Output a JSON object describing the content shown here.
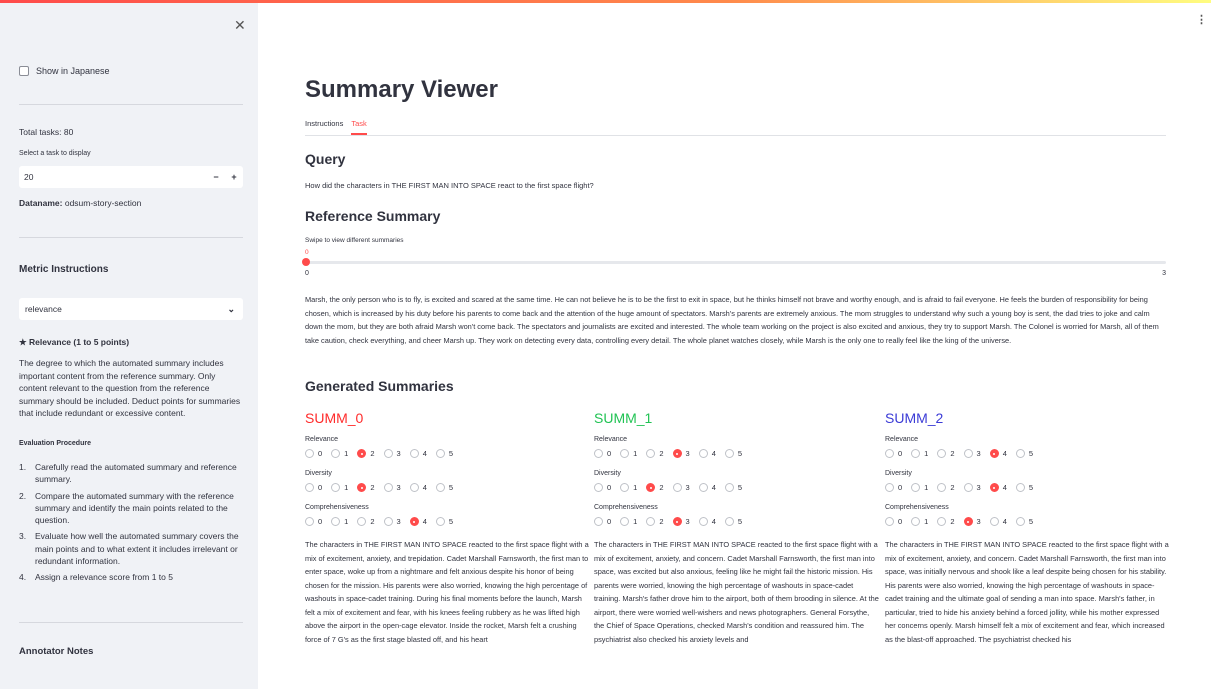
{
  "sidebar": {
    "show_japanese_label": "Show in Japanese",
    "total_tasks": "Total tasks: 80",
    "select_task_label": "Select a task to display",
    "task_value": "20",
    "stepper_minus": "−",
    "stepper_plus": "+",
    "dataname_label": "Dataname:",
    "dataname_value": "odsum-story-section",
    "metric_heading": "Metric Instructions",
    "metric_select": "relevance",
    "metric_title": "★ Relevance (1 to 5 points)",
    "metric_description": "The degree to which the automated summary includes important content from the reference summary. Only content relevant to the question from the reference summary should be included. Deduct points for summaries that include redundant or excessive content.",
    "procedure_heading": "Evaluation Procedure",
    "steps": [
      {
        "num": "1.",
        "text": "Carefully read the automated summary and reference summary."
      },
      {
        "num": "2.",
        "text": "Compare the automated summary with the reference summary and identify the main points related to the question."
      },
      {
        "num": "3.",
        "text": "Evaluate how well the automated summary covers the main points and to what extent it includes irrelevant or redundant information."
      },
      {
        "num": "4.",
        "text": "Assign a relevance score from 1 to 5"
      }
    ],
    "annotator_notes": "Annotator Notes"
  },
  "main": {
    "title": "Summary Viewer",
    "tabs": [
      "Instructions",
      "Task"
    ],
    "query_heading": "Query",
    "query_text": "How did the characters in THE FIRST MAN INTO SPACE react to the first space flight?",
    "reference_heading": "Reference Summary",
    "slider_label": "Swipe to view different summaries",
    "slider_value": "0",
    "slider_min": "0",
    "slider_max": "3",
    "slider_fraction": 0,
    "reference_text": "Marsh, the only person who is to fly, is excited and scared at the same time. He can not believe he is to be the first to exit in space, but he thinks himself not brave and worthy enough, and is afraid to fail everyone. He feels the burden of responsibility for being chosen, which is increased by his duty before his parents to come back and the attention of the huge amount of spectators. Marsh's parents are extremely anxious. The mom struggles to understand why such a young boy is sent, the dad tries to joke and calm down the mom, but they are both afraid Marsh won't come back. The spectators and journalists are excited and interested. The whole team working on the project is also excited and anxious, they try to support Marsh. The Colonel is worried for Marsh, all of them take caution, check everything, and cheer Marsh up. They work on detecting every data, controlling every detail. The whole planet watches closely, while Marsh is the only one to really feel like the king of the universe.",
    "generated_heading": "Generated Summaries",
    "metric_labels": [
      "Relevance",
      "Diversity",
      "Comprehensiveness"
    ],
    "options": [
      "0",
      "1",
      "2",
      "3",
      "4",
      "5"
    ],
    "summaries": [
      {
        "name": "SUMM_0",
        "color": "#ff2b2b",
        "scores": [
          2,
          2,
          4
        ],
        "text": "The characters in THE FIRST MAN INTO SPACE reacted to the first space flight with a mix of excitement, anxiety, and trepidation. Cadet Marshall Farnsworth, the first man to enter space, woke up from a nightmare and felt anxious despite his honor of being chosen for the mission. His parents were also worried, knowing the high percentage of washouts in space-cadet training. During his final moments before the launch, Marsh felt a mix of excitement and fear, with his knees feeling rubbery as he was lifted high above the airport in the open-cage elevator. Inside the rocket, Marsh felt a crushing force of 7 G's as the first stage blasted off, and his heart"
      },
      {
        "name": "SUMM_1",
        "color": "#21c354",
        "scores": [
          3,
          2,
          3
        ],
        "text": "The characters in THE FIRST MAN INTO SPACE reacted to the first space flight with a mix of excitement, anxiety, and concern. Cadet Marshall Farnsworth, the first man into space, was excited but also anxious, feeling like he might fail the historic mission. His parents were worried, knowing the high percentage of washouts in space-cadet training. Marsh's father drove him to the airport, both of them brooding in silence. At the airport, there were worried well-wishers and news photographers. General Forsythe, the Chief of Space Operations, checked Marsh's condition and reassured him. The psychiatrist also checked his anxiety levels and"
      },
      {
        "name": "SUMM_2",
        "color": "#3b3bd6",
        "scores": [
          4,
          4,
          3
        ],
        "text": "The characters in THE FIRST MAN INTO SPACE reacted to the first space flight with a mix of excitement, anxiety, and concern. Cadet Marshall Farnsworth, the first man into space, was initially nervous and shook like a leaf despite being chosen for his stability. His parents were also worried, knowing the high percentage of washouts in space-cadet training and the ultimate goal of sending a man into space. Marsh's father, in particular, tried to hide his anxiety behind a forced jollity, while his mother expressed her concerns openly. Marsh himself felt a mix of excitement and fear, which increased as the blast-off approached. The psychiatrist checked his"
      }
    ]
  },
  "colors": {
    "accent": "#ff4b4b",
    "sidebar_bg": "#f0f2f6"
  }
}
